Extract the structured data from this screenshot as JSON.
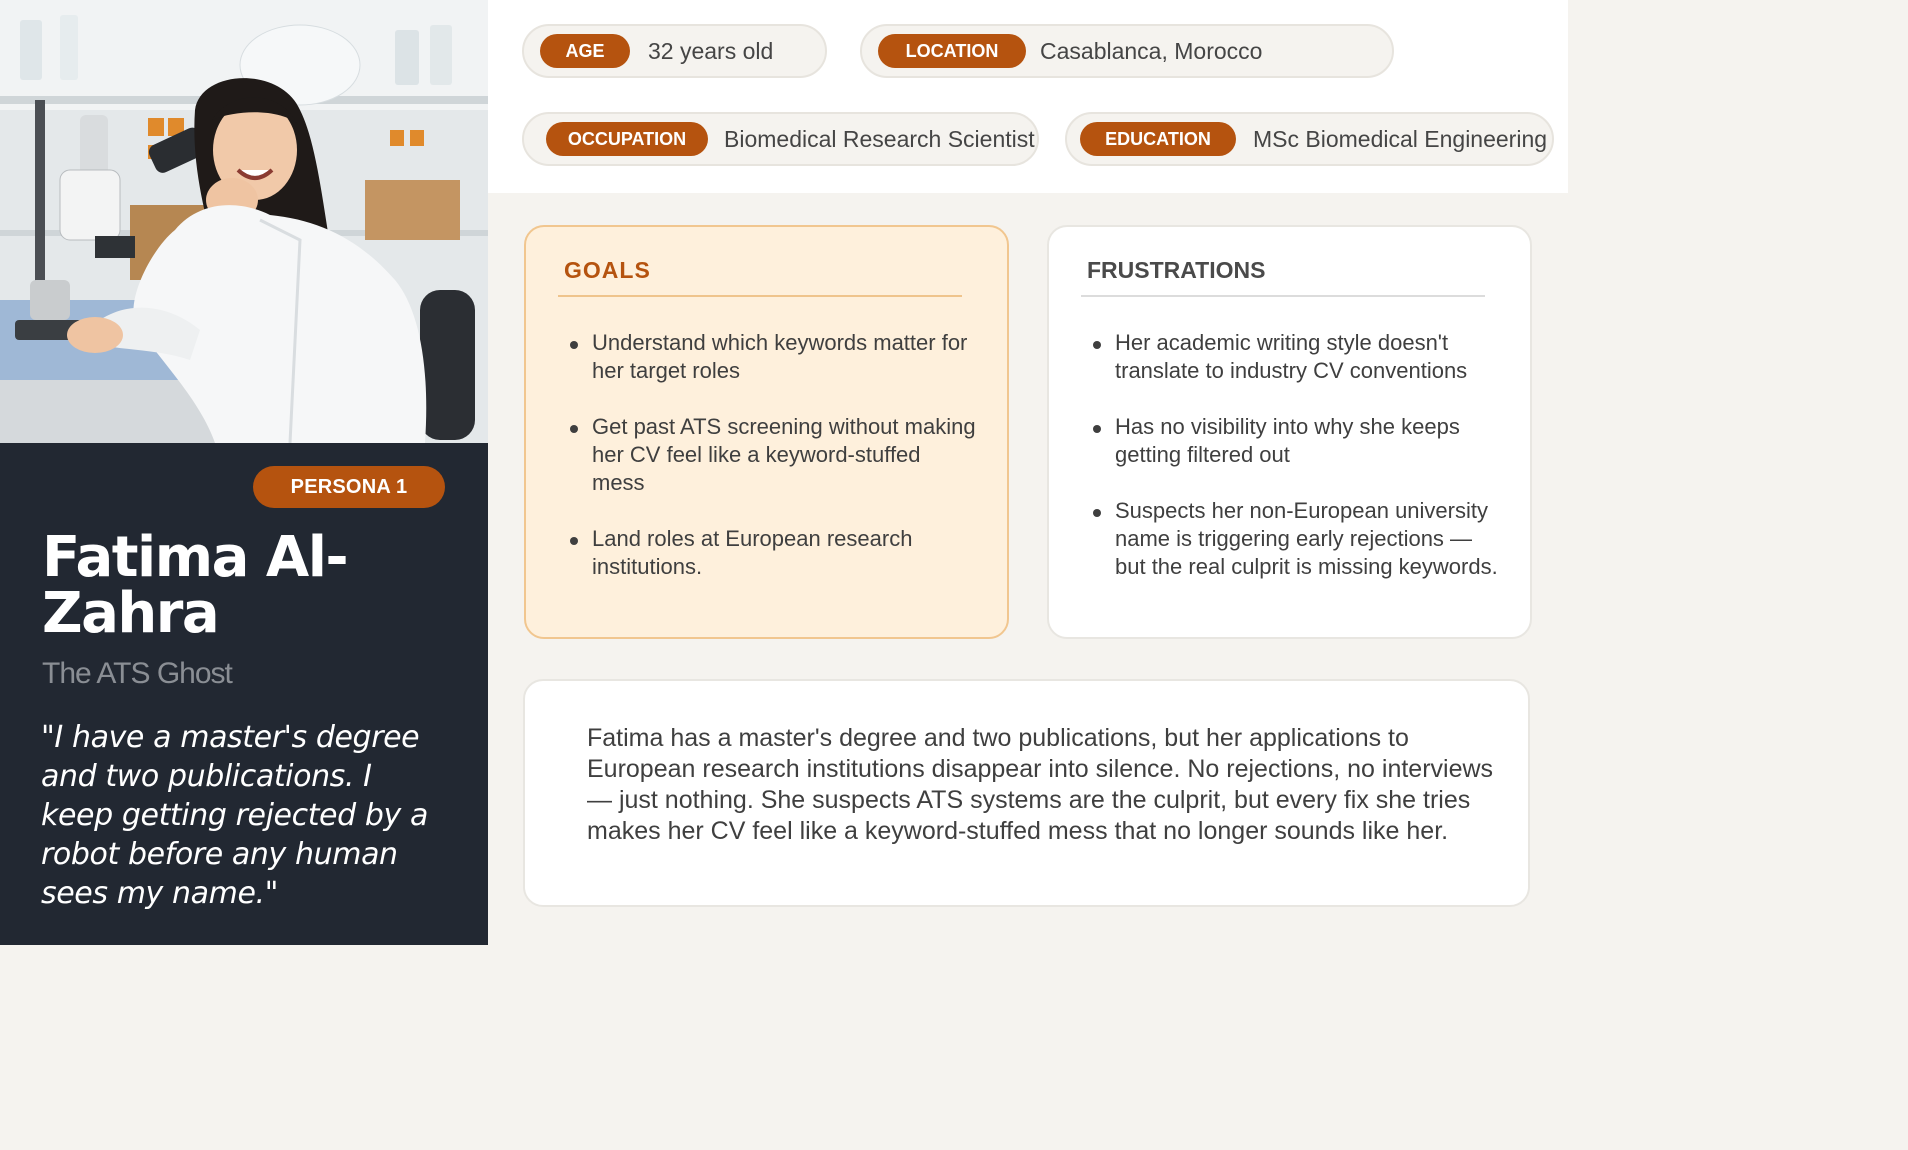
{
  "persona": {
    "badge": "PERSONA 1",
    "name": "Fatima Al-Zahra",
    "archetype": "The ATS Ghost",
    "quote": "\"I have a master's degree and two publications. I keep getting rejected by a robot before any human sees my name.\"",
    "photo_icon": "portrait-photo"
  },
  "info": {
    "age": {
      "label": "AGE",
      "value": "32 years old"
    },
    "location": {
      "label": "LOCATION",
      "value": "Casablanca, Morocco"
    },
    "occupation": {
      "label": "OCCUPATION",
      "value": "Biomedical Research Scientist"
    },
    "education": {
      "label": "EDUCATION",
      "value": "MSc Biomedical Engineering"
    }
  },
  "goals": {
    "title": "GOALS",
    "items": [
      "Understand which keywords matter for her target roles",
      "Get past ATS screening without making her CV feel like a keyword-stuffed mess",
      "Land roles at European research institutions."
    ]
  },
  "frustrations": {
    "title": "FRUSTRATIONS",
    "items": [
      "Her academic writing style doesn't translate to industry CV conventions",
      "Has no visibility into why she keeps getting filtered out",
      "Suspects her non-European university name is triggering early rejections — but the real culprit is missing keywords."
    ]
  },
  "bio": "Fatima has a master's degree and two publications, but her applications to European research institutions disappear into silence. No rejections, no interviews — just nothing. She suspects ATS systems are the culprit, but every fix she tries makes her CV feel like a keyword-stuffed mess that no longer sounds like her.",
  "colors": {
    "accent": "#b5530f",
    "panel_dark": "#222832",
    "goals_bg": "#fef0dc",
    "page_bg": "#f5f3ef"
  }
}
